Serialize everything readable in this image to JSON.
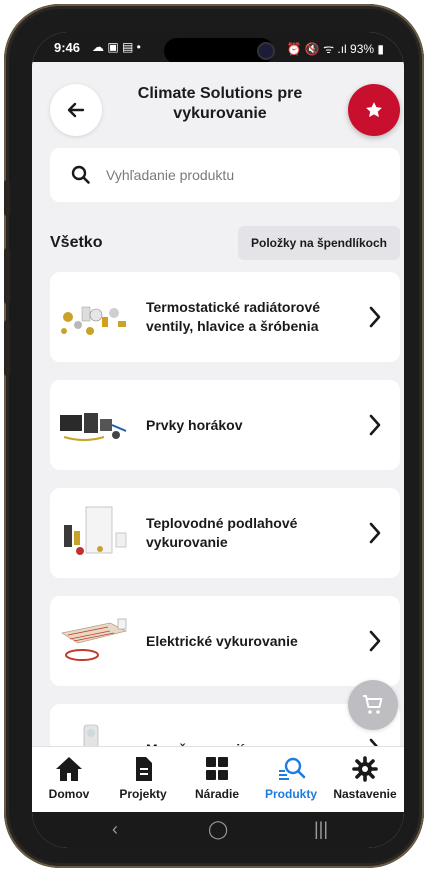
{
  "status_bar": {
    "time": "9:46",
    "left_icons": "☁ ▣ ▤ •",
    "right_icons": "⏰ 🔇 ᯤ .ıl 93% ▮"
  },
  "header": {
    "title": "Climate Solutions pre vykurovanie",
    "back_icon": "arrow-left-icon",
    "favorite_icon": "star-icon",
    "accent_color": "#c8102e"
  },
  "search": {
    "placeholder": "Vyhľadanie produktu",
    "value": ""
  },
  "section": {
    "label": "Všetko",
    "pinned_button": "Položky na špendlíkoch"
  },
  "products": [
    {
      "label": "Termostatické radiátorové ventily, hlavice a šróbenia"
    },
    {
      "label": "Prvky horákov"
    },
    {
      "label": "Teplovodné podlahové vykurovanie"
    },
    {
      "label": "Elektrické vykurovanie"
    },
    {
      "label": "Merače energií"
    }
  ],
  "bottom_nav": {
    "items": [
      {
        "label": "Domov",
        "icon": "home-icon"
      },
      {
        "label": "Projekty",
        "icon": "document-icon"
      },
      {
        "label": "Náradie",
        "icon": "grid-icon"
      },
      {
        "label": "Produkty",
        "icon": "search-products-icon"
      },
      {
        "label": "Nastavenie",
        "icon": "gear-icon"
      }
    ],
    "active": "Produkty",
    "active_color": "#1e7be0"
  },
  "system_nav": {
    "back": "‹",
    "home": "◯",
    "recents": "|||"
  }
}
